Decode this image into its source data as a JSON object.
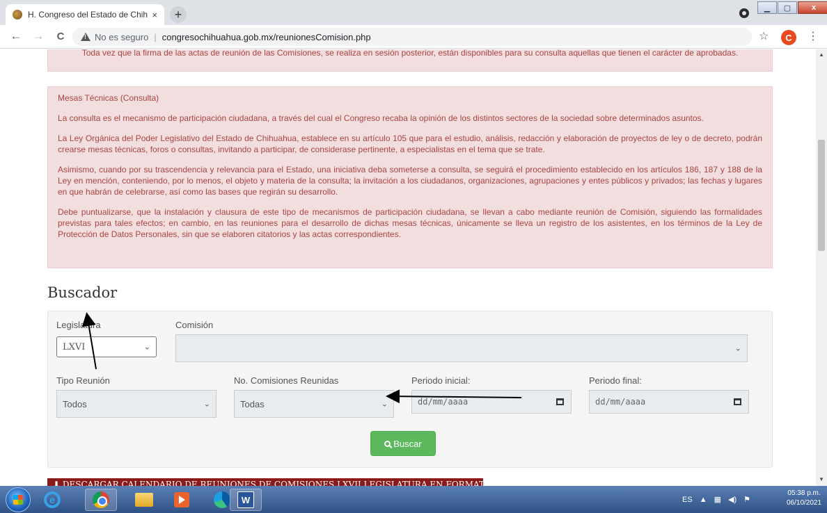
{
  "browser": {
    "tab_title": "H. Congreso del Estado de Chihu",
    "tab_close": "×",
    "newtab": "+",
    "nav_back": "←",
    "nav_forward": "→",
    "nav_reload": "C",
    "not_secure": "No es seguro",
    "url": "congresochihuahua.gob.mx/reunionesComision.php",
    "star": "☆",
    "avatar_letter": "C",
    "menu": "⋮",
    "win_min": "▁",
    "win_max": "▢",
    "win_close": "x"
  },
  "alerts": {
    "top_text": "Toda vez que la firma de las actas de reunión de las Comisiones, se realiza en sesión posterior, están disponibles para su consulta aquellas que tienen el carácter de aprobadas.",
    "heading": "Mesas Técnicas (Consulta)",
    "p1": "La consulta es el mecanismo de participación ciudadana, a través del cual el Congreso recaba la opinión de los distintos sectores de la sociedad sobre determinados asuntos.",
    "p2": "La Ley Orgánica del Poder Legislativo del Estado de Chihuahua, establece en su artículo 105 que para el estudio, análisis, redacción y elaboración de proyectos de ley o de decreto, podrán crearse mesas técnicas, foros o consultas, invitando a participar, de considerase pertinente, a especialistas en el tema que se trate.",
    "p3": "Asimismo, cuando por su trascendencia y relevancia para el Estado, una iniciativa deba someterse a consulta, se seguirá el procedimiento establecido en los artículos 186, 187 y 188 de la Ley en mención, conteniendo, por lo menos, el objeto y materia de la consulta; la invitación a los ciudadanos, organizaciones, agrupaciones y entes públicos y privados; las fechas y lugares en que habrán de celebrarse, así como las bases que regirán su desarrollo.",
    "p4": "Debe puntualizarse, que la instalación y clausura de este tipo de mecanismos de participación ciudadana, se llevan a cabo mediante reunión de Comisión, siguiendo las formalidades previstas para tales efectos; en cambio, en las reuniones para el desarrollo de dichas mesas técnicas, únicamente se lleva un registro de los asistentes, en los términos de la Ley de Protección de Datos Personales, sin que se elaboren citatorios y las actas correspondientes."
  },
  "search": {
    "title": "Buscador",
    "legislatura_label": "Legislatura",
    "legislatura_value": "LXVI",
    "comision_label": "Comisión",
    "comision_value": "",
    "tipo_label": "Tipo Reunión",
    "tipo_value": "Todos",
    "comisiones_label": "No. Comisiones Reunidas",
    "comisiones_value": "Todas",
    "periodo_inicial_label": "Periodo inicial:",
    "periodo_final_label": "Periodo final:",
    "date_placeholder": "dd/mm/aaaa",
    "button_label": "Buscar"
  },
  "download_button": "DESCARGAR CALENDARIO DE REUNIONES DE COMISIONES LXVII LEGISLATURA EN FORMATO CSV",
  "taskbar": {
    "lang": "ES",
    "time": "05:38 p.m.",
    "date": "06/10/2021",
    "word_letter": "W",
    "ie_letter": "e"
  },
  "colors": {
    "alert_bg": "#f2dede",
    "alert_text": "#a94442",
    "button_green": "#5cb85c",
    "csv_button": "#8b1a1a",
    "arrow": "#000000"
  }
}
